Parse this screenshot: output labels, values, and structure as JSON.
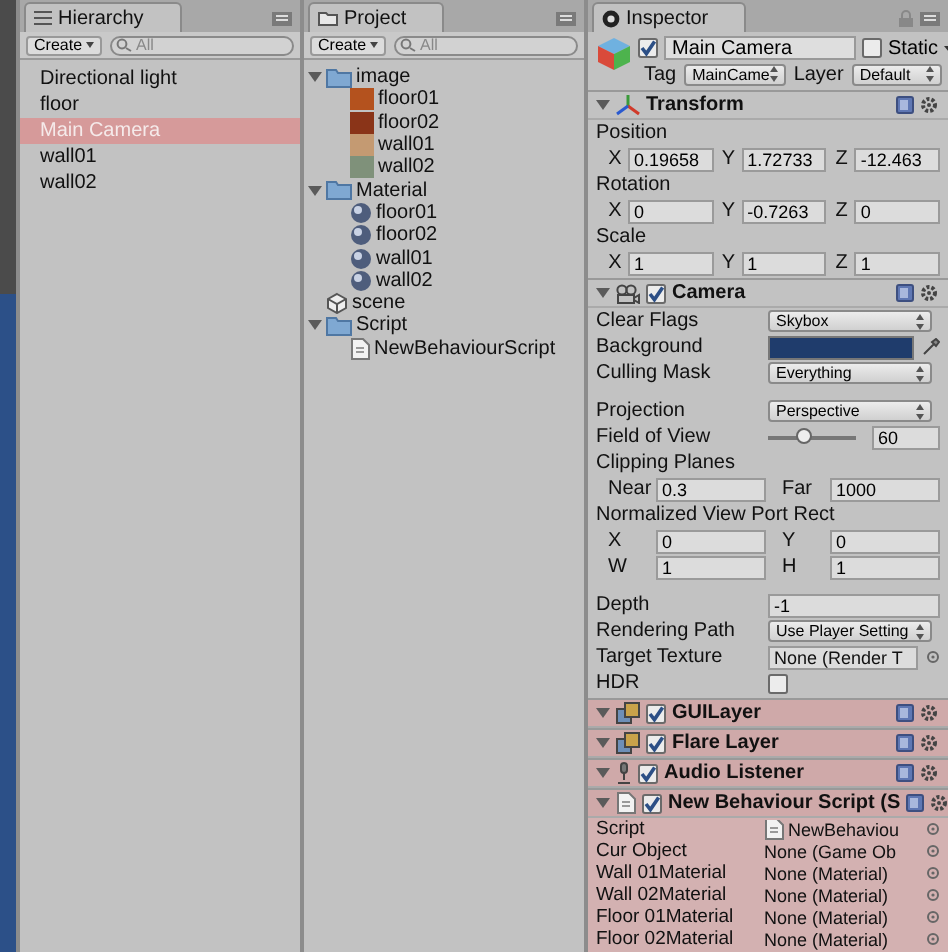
{
  "hierarchy": {
    "tab": "Hierarchy",
    "create": "Create",
    "search_placeholder": "All",
    "items": [
      {
        "label": "Directional light",
        "selected": false
      },
      {
        "label": "floor",
        "selected": false
      },
      {
        "label": "Main Camera",
        "selected": true
      },
      {
        "label": "wall01",
        "selected": false
      },
      {
        "label": "wall02",
        "selected": false
      }
    ]
  },
  "project": {
    "tab": "Project",
    "create": "Create",
    "search_placeholder": "All",
    "tree": [
      {
        "label": "image",
        "kind": "folder",
        "expanded": true,
        "children": [
          {
            "label": "floor01",
            "kind": "texture",
            "color": "#b4521e"
          },
          {
            "label": "floor02",
            "kind": "texture",
            "color": "#8a3418"
          },
          {
            "label": "wall01",
            "kind": "texture",
            "color": "#c49a72"
          },
          {
            "label": "wall02",
            "kind": "texture",
            "color": "#7f917a"
          }
        ]
      },
      {
        "label": "Material",
        "kind": "folder",
        "expanded": true,
        "children": [
          {
            "label": "floor01",
            "kind": "material"
          },
          {
            "label": "floor02",
            "kind": "material"
          },
          {
            "label": "wall01",
            "kind": "material"
          },
          {
            "label": "wall02",
            "kind": "material"
          }
        ]
      },
      {
        "label": "scene",
        "kind": "scene"
      },
      {
        "label": "Script",
        "kind": "folder",
        "expanded": true,
        "children": [
          {
            "label": "NewBehaviourScript",
            "kind": "script"
          }
        ]
      }
    ]
  },
  "inspector": {
    "tab": "Inspector",
    "object": {
      "active": true,
      "name": "Main Camera",
      "static": false,
      "static_label": "Static",
      "tag_label": "Tag",
      "tag": "MainCame",
      "layer_label": "Layer",
      "layer": "Default"
    },
    "components": [
      {
        "kind": "transform",
        "name": "Transform",
        "expanded": true,
        "rows": [
          {
            "label": "Position",
            "values": [
              {
                "axis": "X",
                "value": "0.19658"
              },
              {
                "axis": "Y",
                "value": "1.72733"
              },
              {
                "axis": "Z",
                "value": "-12.463"
              }
            ]
          },
          {
            "label": "Rotation",
            "values": [
              {
                "axis": "X",
                "value": "0"
              },
              {
                "axis": "Y",
                "value": "-0.7263"
              },
              {
                "axis": "Z",
                "value": "0"
              }
            ]
          },
          {
            "label": "Scale",
            "values": [
              {
                "axis": "X",
                "value": "1"
              },
              {
                "axis": "Y",
                "value": "1"
              },
              {
                "axis": "Z",
                "value": "1"
              }
            ]
          }
        ]
      },
      {
        "kind": "camera",
        "name": "Camera",
        "expanded": true,
        "enabled": true,
        "properties": [
          {
            "kind": "dropdown",
            "label": "Clear Flags",
            "value": "Skybox"
          },
          {
            "kind": "color",
            "label": "Background",
            "color": "#1f3c6c"
          },
          {
            "kind": "dropdown",
            "label": "Culling Mask",
            "value": "Everything"
          },
          {
            "kind": "dropdown",
            "label": "Projection",
            "value": "Perspective",
            "gap_before": true
          },
          {
            "kind": "slider",
            "label": "Field of View",
            "level": 0.4,
            "value": "60"
          },
          {
            "kind": "heading",
            "label": "Clipping Planes"
          },
          {
            "kind": "pair",
            "items": [
              {
                "label": "Near",
                "value": "0.3"
              },
              {
                "label": "Far",
                "value": "1000"
              }
            ]
          },
          {
            "kind": "heading",
            "label": "Normalized View Port Rect"
          },
          {
            "kind": "pair",
            "items": [
              {
                "label": "X",
                "value": "0"
              },
              {
                "label": "Y",
                "value": "0"
              }
            ]
          },
          {
            "kind": "pair",
            "items": [
              {
                "label": "W",
                "value": "1"
              },
              {
                "label": "H",
                "value": "1"
              }
            ]
          },
          {
            "kind": "field",
            "label": "Depth",
            "value": "-1",
            "gap_before": true
          },
          {
            "kind": "dropdown",
            "label": "Rendering Path",
            "value": "Use Player Setting"
          },
          {
            "kind": "object",
            "label": "Target Texture",
            "value": "None (Render T"
          },
          {
            "kind": "checkbox",
            "label": "HDR",
            "checked": false
          }
        ]
      },
      {
        "kind": "gui_layer",
        "name": "GUILayer",
        "expanded": true,
        "enabled": true,
        "highlighted": true
      },
      {
        "kind": "flare_layer",
        "name": "Flare Layer",
        "expanded": true,
        "enabled": true,
        "highlighted": true
      },
      {
        "kind": "audio_listener",
        "name": "Audio Listener",
        "expanded": true,
        "enabled": true,
        "highlighted": true
      },
      {
        "kind": "script",
        "name": "New Behaviour Script (S",
        "expanded": true,
        "enabled": true,
        "highlighted": true,
        "fields": [
          {
            "kind": "script",
            "label": "Script",
            "value": "NewBehaviou"
          },
          {
            "kind": "object",
            "label": "Cur Object",
            "value": "None (Game Ob"
          },
          {
            "kind": "object",
            "label": "Wall 01Material",
            "value": "None (Material)"
          },
          {
            "kind": "object",
            "label": "Wall 02Material",
            "value": "None (Material)"
          },
          {
            "kind": "object",
            "label": "Floor 01Material",
            "value": "None (Material)"
          },
          {
            "kind": "object",
            "label": "Floor 02Material",
            "value": "None (Material)"
          }
        ]
      }
    ]
  }
}
